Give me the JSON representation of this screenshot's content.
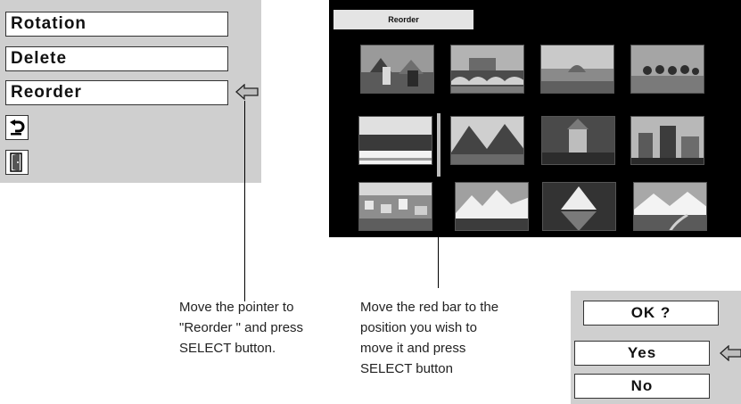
{
  "menu": {
    "items": [
      {
        "label": "Rotation"
      },
      {
        "label": "Delete"
      },
      {
        "label": "Reorder"
      }
    ],
    "back_icon": "undo-arrow-icon",
    "exit_icon": "exit-door-icon",
    "pointer_icon": "pointer-arrow-icon"
  },
  "screen": {
    "title": "Reorder",
    "thumbnails": [
      "town",
      "bridge",
      "fog",
      "trees",
      "field",
      "valley",
      "castle",
      "city",
      "village",
      "mountains",
      "matterhorn",
      "alps"
    ]
  },
  "captions": {
    "menu_hint": [
      "Move the pointer to",
      "\"Reorder \" and press",
      "SELECT button."
    ],
    "bar_hint": [
      "Move the red bar to the",
      "position you wish to",
      "move it and press",
      "SELECT button"
    ]
  },
  "confirm": {
    "question": "OK ?",
    "yes": "Yes",
    "no": "No"
  },
  "colors": {
    "panel": "#cfcfcf",
    "screen": "#000000",
    "bar": "#bdbdbd"
  }
}
